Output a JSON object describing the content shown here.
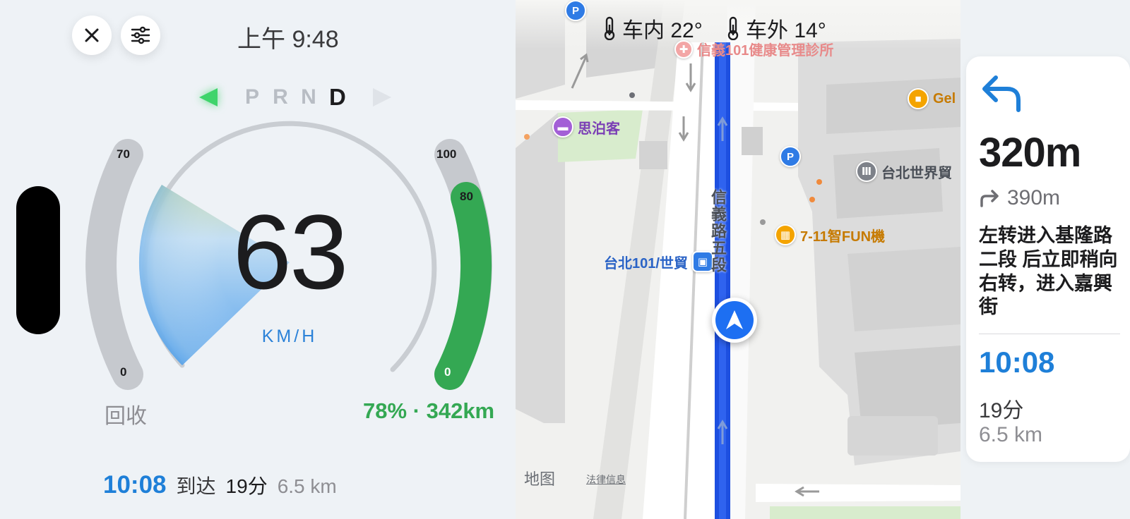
{
  "status": {
    "time": "上午 9:48"
  },
  "gears": {
    "items": [
      "P",
      "R",
      "N",
      "D"
    ],
    "selected": "D"
  },
  "speedometer": {
    "speed": "63",
    "unit": "KM/H",
    "speed_fraction": 0.63
  },
  "regen_gauge": {
    "max_label": "70",
    "min_label": "0",
    "label": "回收"
  },
  "battery_gauge": {
    "max_label": "100",
    "mark_label": "80",
    "min_label": "0",
    "percent": 78,
    "label": "78% · 342km"
  },
  "trip": {
    "eta": "10:08",
    "arrive_label": "到达",
    "duration": "19分",
    "distance": "6.5 km"
  },
  "climate": {
    "inside": "车内 22°",
    "outside": "车外 14°"
  },
  "map": {
    "clinic": "信義101健康管理診所",
    "hotel": "思泊客",
    "store_partial": "Gel",
    "wtc": "台北世界貿",
    "seven": "7-11智FUN機",
    "metro": "台北101/世貿",
    "street": "信義路五段",
    "brand": "地图",
    "legal": "法律信息"
  },
  "direction": {
    "distance": "320m",
    "next_distance": "390m",
    "instruction": "左转进入基隆路二段 后立即稍向右转，进入嘉興街",
    "eta": "10:08",
    "duration": "19分",
    "remaining": "6.5 km"
  },
  "colors": {
    "accent_blue": "#1e7fd8",
    "battery_green": "#34a853",
    "route_blue": "#1d4fe0",
    "gear_green": "#3fd46b"
  },
  "icons": {
    "close": "close-icon",
    "settings": "sliders-icon",
    "thermometer": "thermometer-icon",
    "turn_left": "turn-left-arrow-icon",
    "bear_right": "turn-right-arrow-icon",
    "nav_puck": "navigation-arrow-icon",
    "parking": "parking-icon",
    "hotel": "bed-icon",
    "metro": "train-icon",
    "shopping": "shopping-bag-icon",
    "store": "store-icon",
    "landmark": "landmark-icon"
  }
}
